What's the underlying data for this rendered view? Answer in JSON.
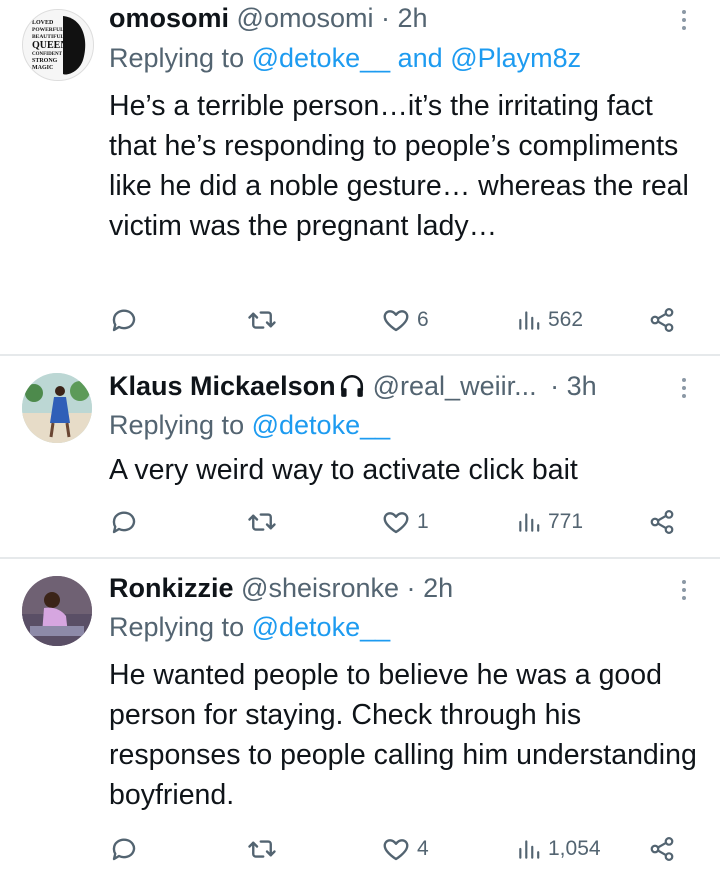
{
  "tweets": [
    {
      "name": "omosomi",
      "handle": "@omosomi",
      "dot": "·",
      "time": "2h",
      "reply_prefix": "Replying to",
      "mentions": [
        "@detoke__",
        "@Playm8z"
      ],
      "mention_joiner": "and",
      "body": "He’s a terrible person…it’s the irritating fact that he’s responding to people’s compliments like he did a noble gesture… whereas the real victim was the pregnant lady…",
      "stats": {
        "replies": "",
        "reposts": "",
        "likes": "6",
        "views": "562"
      },
      "avatar_text": [
        "LOVED",
        "POWERFUL",
        "BEAUTIFUL",
        "QUEEN",
        "CONFIDENT",
        "STRONG",
        "MAGIC"
      ]
    },
    {
      "name": "Klaus Mickaelson",
      "handle": "@real_weiir...",
      "dot": "·",
      "time": "3h",
      "reply_prefix": "Replying to",
      "mentions": [
        "@detoke__"
      ],
      "body": "A very weird way to activate click bait",
      "stats": {
        "replies": "",
        "reposts": "",
        "likes": "1",
        "views": "771"
      }
    },
    {
      "name": "Ronkizzie",
      "handle": "@sheisronke",
      "dot": "·",
      "time": "2h",
      "reply_prefix": "Replying to",
      "mentions": [
        "@detoke__"
      ],
      "body": "He wanted people to believe he was a good person for staying. Check through his responses to people calling him understanding boyfriend.",
      "stats": {
        "replies": "",
        "reposts": "",
        "likes": "4",
        "views": "1,054"
      }
    }
  ],
  "colors": {
    "text": "#0f1419",
    "muted": "#536471",
    "link": "#1d9bf0",
    "divider": "#e6e9eb"
  },
  "icons": [
    "reply-icon",
    "repost-icon",
    "like-icon",
    "views-icon",
    "share-icon",
    "more-icon",
    "headphones-icon"
  ]
}
